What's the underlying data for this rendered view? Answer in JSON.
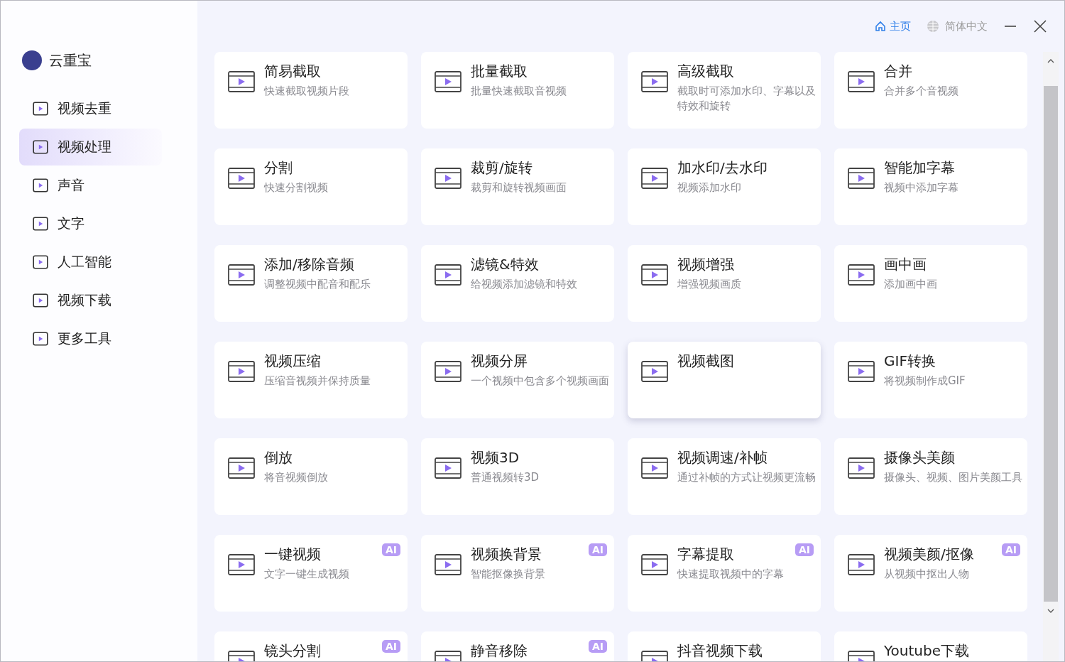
{
  "app": {
    "title": "云重宝"
  },
  "header": {
    "home": "主页",
    "language": "简体中文"
  },
  "sidebar": {
    "items": [
      {
        "label": "视频去重",
        "selected": false
      },
      {
        "label": "视频处理",
        "selected": true
      },
      {
        "label": "声音",
        "selected": false
      },
      {
        "label": "文字",
        "selected": false
      },
      {
        "label": "人工智能",
        "selected": false
      },
      {
        "label": "视频下载",
        "selected": false
      },
      {
        "label": "更多工具",
        "selected": false
      }
    ]
  },
  "tools": [
    {
      "title": "简易截取",
      "subtitle": "快速截取视频片段",
      "hovered": false
    },
    {
      "title": "批量截取",
      "subtitle": "批量快速截取音视频",
      "hovered": false
    },
    {
      "title": "高级截取",
      "subtitle": "截取时可添加水印、字幕以及特效和旋转",
      "hovered": false
    },
    {
      "title": "合并",
      "subtitle": "合并多个音视频",
      "hovered": false
    },
    {
      "title": "分割",
      "subtitle": "快速分割视频",
      "hovered": false
    },
    {
      "title": "裁剪/旋转",
      "subtitle": "裁剪和旋转视频画面",
      "hovered": false
    },
    {
      "title": "加水印/去水印",
      "subtitle": "视频添加水印",
      "hovered": false
    },
    {
      "title": "智能加字幕",
      "subtitle": "视频中添加字幕",
      "hovered": false
    },
    {
      "title": "添加/移除音频",
      "subtitle": "调整视频中配音和配乐",
      "hovered": false
    },
    {
      "title": "滤镜&特效",
      "subtitle": "给视频添加滤镜和特效",
      "hovered": false
    },
    {
      "title": "视频增强",
      "subtitle": "增强视频画质",
      "hovered": false
    },
    {
      "title": "画中画",
      "subtitle": "添加画中画",
      "hovered": false
    },
    {
      "title": "视频压缩",
      "subtitle": "压缩音视频并保持质量",
      "hovered": false
    },
    {
      "title": "视频分屏",
      "subtitle": "一个视频中包含多个视频画面",
      "hovered": false
    },
    {
      "title": "视频截图",
      "hovered": true
    },
    {
      "title": "GIF转换",
      "subtitle": "将视频制作成GIF",
      "hovered": false
    },
    {
      "title": "倒放",
      "subtitle": "将音视频倒放",
      "hovered": false
    },
    {
      "title": "视频3D",
      "subtitle": "普通视频转3D",
      "hovered": false
    },
    {
      "title": "视频调速/补帧",
      "subtitle": "通过补帧的方式让视频更流畅",
      "hovered": false
    },
    {
      "title": "摄像头美颜",
      "subtitle": "摄像头、视频、图片美颜工具",
      "hovered": false
    },
    {
      "title": "一键视频",
      "subtitle": "文字一键生成视频",
      "badge": "AI",
      "hovered": false
    },
    {
      "title": "视频换背景",
      "subtitle": "智能抠像换背景",
      "badge": "AI",
      "hovered": false
    },
    {
      "title": "字幕提取",
      "subtitle": "快速提取视频中的字幕",
      "badge": "AI",
      "hovered": false
    },
    {
      "title": "视频美颜/抠像",
      "subtitle": "从视频中抠出人物",
      "badge": "AI",
      "hovered": false
    },
    {
      "title": "镜头分割",
      "badge": "AI",
      "hovered": false
    },
    {
      "title": "静音移除",
      "badge": "AI",
      "hovered": false
    },
    {
      "title": "抖音视频下载",
      "hovered": false
    },
    {
      "title": "Youtube下载",
      "hovered": false
    }
  ]
}
